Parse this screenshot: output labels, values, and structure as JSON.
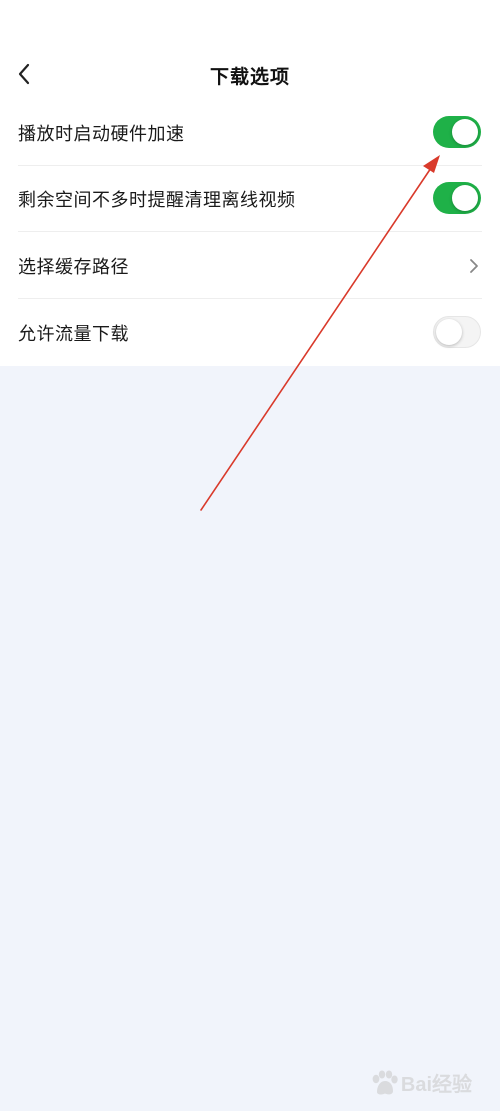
{
  "header": {
    "title": "下载选项",
    "back_icon": "chevron-left-icon"
  },
  "settings": [
    {
      "label": "播放时启动硬件加速",
      "control": "toggle",
      "enabled": true
    },
    {
      "label": "剩余空间不多时提醒清理离线视频",
      "control": "toggle",
      "enabled": true
    },
    {
      "label": "选择缓存路径",
      "control": "chevron",
      "icon": "chevron-right-icon"
    },
    {
      "label": "允许流量下载",
      "control": "toggle",
      "enabled": false
    }
  ],
  "colors": {
    "toggle_on": "#1fb148",
    "toggle_off": "#f4f4f4",
    "page_background": "#f1f4fb",
    "panel_background": "#ffffff",
    "annotation_arrow": "#d93a2b"
  },
  "watermark": {
    "text": "Bai经验",
    "icon": "baidu-paw-icon"
  }
}
